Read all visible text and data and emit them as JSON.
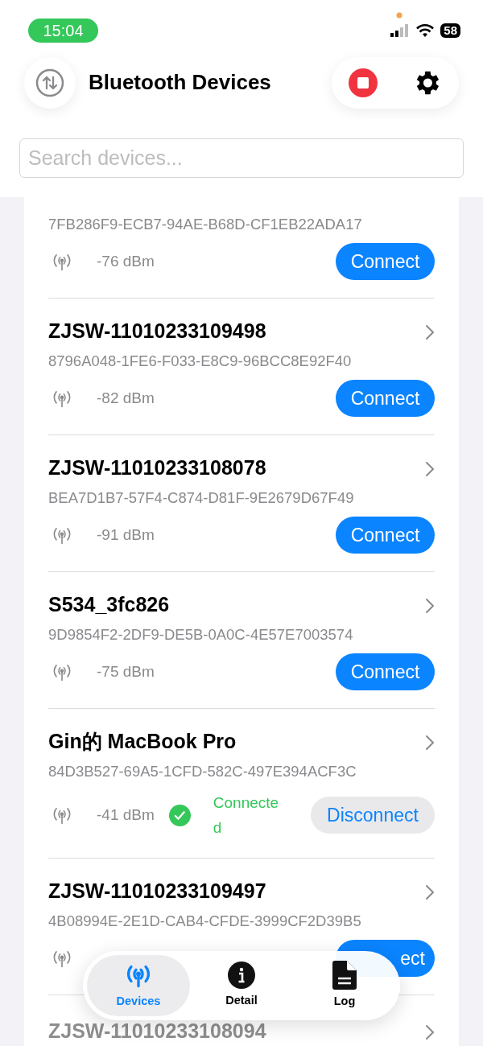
{
  "status_bar": {
    "time": "15:04",
    "battery": "58"
  },
  "header": {
    "title": "Bluetooth Devices"
  },
  "search": {
    "placeholder": "Search devices..."
  },
  "devices": [
    {
      "kind": "device",
      "uuid": "7FB286F9-ECB7-94AE-B68D-CF1EB22ADA17",
      "rssi": "-76 dBm",
      "connected": false,
      "button": "Connect"
    },
    {
      "kind": "device",
      "name": "ZJSW-11010233109498",
      "uuid": "8796A048-1FE6-F033-E8C9-96BCC8E92F40",
      "rssi": "-82 dBm",
      "connected": false,
      "button": "Connect"
    },
    {
      "kind": "device",
      "name": "ZJSW-11010233108078",
      "uuid": "BEA7D1B7-57F4-C874-D81F-9E2679D67F49",
      "rssi": "-91 dBm",
      "connected": false,
      "button": "Connect"
    },
    {
      "kind": "device",
      "name": "S534_3fc826",
      "uuid": "9D9854F2-2DF9-DE5B-0A0C-4E57E7003574",
      "rssi": "-75 dBm",
      "connected": false,
      "button": "Connect"
    },
    {
      "kind": "device",
      "name": "Gin的 MacBook Pro",
      "uuid": "84D3B527-69A5-1CFD-582C-497E394ACF3C",
      "rssi": "-41 dBm",
      "connected": true,
      "status": "Connected",
      "button": "Disconnect"
    },
    {
      "kind": "device",
      "name": "ZJSW-11010233109497",
      "uuid": "4B08994E-2E1D-CAB4-CFDE-3999CF2D39B5",
      "connected": false,
      "button": "ect"
    },
    {
      "kind": "faded",
      "name": "ZJSW-11010233108094"
    }
  ],
  "tab_bar": [
    {
      "label": "Devices",
      "selected": true
    },
    {
      "label": "Detail",
      "selected": false
    },
    {
      "label": "Log",
      "selected": false
    }
  ]
}
